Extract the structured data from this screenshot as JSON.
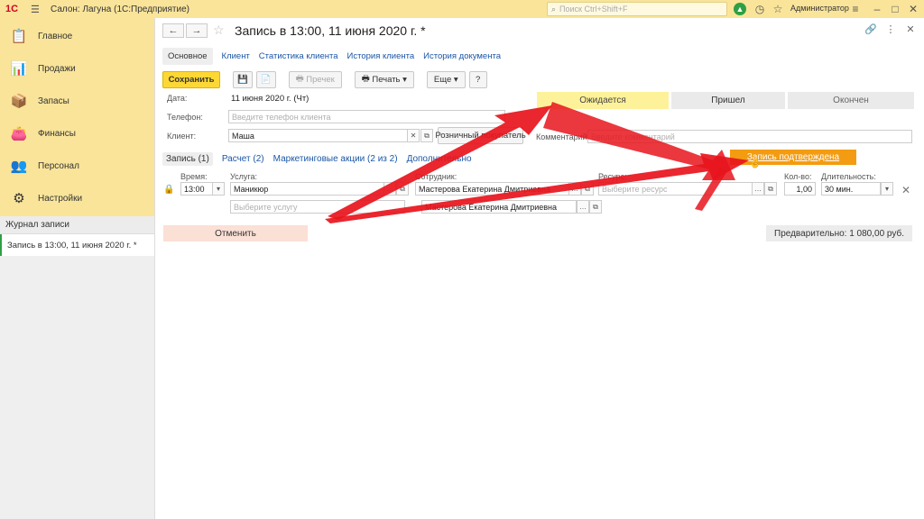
{
  "titlebar": {
    "logo": "1С",
    "title": "Салон: Лагуна  (1С:Предприятие)",
    "search_placeholder": "Поиск Ctrl+Shift+F",
    "user": "Администратор"
  },
  "sidebar": {
    "sections": [
      {
        "label": "Главное",
        "icon": "list-icon"
      },
      {
        "label": "Продажи",
        "icon": "chart-icon"
      },
      {
        "label": "Запасы",
        "icon": "boxes-icon"
      },
      {
        "label": "Финансы",
        "icon": "wallet-icon"
      },
      {
        "label": "Персонал",
        "icon": "people-icon"
      },
      {
        "label": "Настройки",
        "icon": "gear-icon"
      }
    ],
    "journal": "Журнал записи",
    "open_doc": "Запись в 13:00, 11 июня 2020 г. *"
  },
  "doc": {
    "title": "Запись в 13:00, 11 июня 2020 г. *",
    "tabs": [
      "Основное",
      "Клиент",
      "Статистика клиента",
      "История клиента",
      "История документа"
    ],
    "toolbar": {
      "save": "Сохранить",
      "receipt": "Пречек",
      "print": "Печать",
      "more": "Еще",
      "help": "?"
    },
    "date_label": "Дата:",
    "date_value": "11 июня 2020 г. (Чт)",
    "phone_label": "Телефон:",
    "phone_placeholder": "Введите телефон клиента",
    "client_label": "Клиент:",
    "client_value": "Маша",
    "retail_button": "Розничный покупатель",
    "comment_label": "Комментарий:",
    "comment_placeholder": "Введите комментарий",
    "statuses": {
      "expected": "Ожидается",
      "came": "Пришел",
      "done": "Окончен"
    },
    "confirmed": "Запись подтверждена",
    "subtabs": [
      "Запись (1)",
      "Расчет (2)",
      "Маркетинговые акции (2 из 2)",
      "Дополнительно"
    ],
    "row": {
      "time_label": "Время:",
      "time_value": "13:00",
      "service_label": "Услуга:",
      "service_value": "Маникюр",
      "service_placeholder": "Выберите услугу",
      "employee_label": "Сотрудник:",
      "employee_value": "Мастерова Екатерина Дмитриевна",
      "employee_value2": "Мастерова Екатерина Дмитриевна",
      "resource_label": "Ресурс:",
      "resource_placeholder": "Выберите ресурс",
      "qty_label": "Кол-во:",
      "qty_value": "1,00",
      "duration_label": "Длительность:",
      "duration_value": "30 мин."
    },
    "cancel": "Отменить",
    "total": "Предварительно: 1 080,00 руб."
  },
  "colors": {
    "accent_yellow": "#f9e49a",
    "save_button": "#fdd835",
    "confirmed": "#f39c12",
    "arrow": "#e8141c"
  }
}
